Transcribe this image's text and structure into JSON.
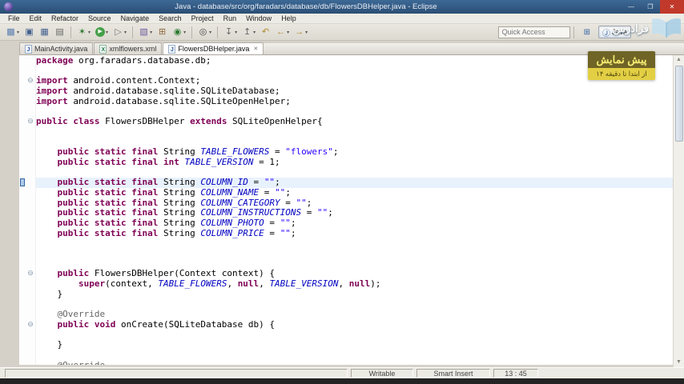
{
  "window": {
    "title": "Java - database/src/org/faradars/database/db/FlowersDBHelper.java - Eclipse",
    "controls": {
      "minimize": "—",
      "maximize": "❐",
      "close": "✕"
    }
  },
  "menubar": {
    "items": [
      "File",
      "Edit",
      "Refactor",
      "Source",
      "Navigate",
      "Search",
      "Project",
      "Run",
      "Window",
      "Help"
    ]
  },
  "toolbar": {
    "dd_glyph": "▾",
    "quick_access_placeholder": "Quick Access",
    "groups": [
      [
        {
          "name": "new-wizard-icon",
          "glyph": "▩",
          "color": "#5b7fb0",
          "dd": true
        },
        {
          "name": "save-icon",
          "glyph": "▣",
          "color": "#44618f"
        },
        {
          "name": "save-all-icon",
          "glyph": "▦",
          "color": "#44618f"
        },
        {
          "name": "print-icon",
          "glyph": "▤",
          "color": "#666666"
        }
      ],
      [
        {
          "name": "debug-icon",
          "glyph": "✶",
          "color": "#2e7d32",
          "dd": true
        },
        {
          "name": "run-icon",
          "glyph": "▶",
          "color": "#ffffff",
          "bg": "#43a047",
          "round": true,
          "dd": true
        },
        {
          "name": "run-external-tools-icon",
          "glyph": "▷",
          "color": "#777777",
          "dd": true
        }
      ],
      [
        {
          "name": "new-java-project-icon",
          "glyph": "▧",
          "color": "#6d5b9c",
          "dd": true
        },
        {
          "name": "new-package-icon",
          "glyph": "⊞",
          "color": "#8a6a3a"
        },
        {
          "name": "new-class-icon",
          "glyph": "◉",
          "color": "#2e7d32",
          "dd": true
        }
      ],
      [
        {
          "name": "search-icon",
          "glyph": "◎",
          "color": "#444444",
          "dd": true
        }
      ],
      [
        {
          "name": "next-annotation-icon",
          "glyph": "↧",
          "color": "#666666",
          "dd": true
        },
        {
          "name": "prev-annotation-icon",
          "glyph": "↥",
          "color": "#666666",
          "dd": true
        },
        {
          "name": "last-edit-location-icon",
          "glyph": "↶",
          "color": "#b08a2e"
        },
        {
          "name": "back-icon",
          "glyph": "←",
          "color": "#b08a2e",
          "dd": true
        },
        {
          "name": "forward-icon",
          "glyph": "→",
          "color": "#b08a2e",
          "dd": true
        }
      ]
    ],
    "perspectives": [
      {
        "name": "open-perspective-button",
        "glyph": "⊞",
        "label": "",
        "active": false
      },
      {
        "name": "java-perspective-button",
        "glyph": "Ⓙ",
        "label": "Java",
        "active": true
      }
    ]
  },
  "tabs": [
    {
      "label": "MainActivity.java",
      "icon": "J",
      "icon_class": "java",
      "active": false
    },
    {
      "label": "xmlflowers.xml",
      "icon": "X",
      "icon_class": "xml",
      "active": false
    },
    {
      "label": "FlowersDBHelper.java",
      "icon": "J",
      "icon_class": "java",
      "active": true,
      "close": "✕"
    }
  ],
  "editor": {
    "fold_glyph": "⊖",
    "lines": [
      {
        "seg": [
          [
            "k",
            "package"
          ],
          [
            "p",
            " org.faradars.database.db;"
          ]
        ]
      },
      {
        "seg": []
      },
      {
        "fold": true,
        "seg": [
          [
            "k",
            "import"
          ],
          [
            "p",
            " android.content.Context;"
          ]
        ]
      },
      {
        "seg": [
          [
            "k",
            "import"
          ],
          [
            "p",
            " android.database.sqlite.SQLiteDatabase;"
          ]
        ]
      },
      {
        "seg": [
          [
            "k",
            "import"
          ],
          [
            "p",
            " android.database.sqlite.SQLiteOpenHelper;"
          ]
        ]
      },
      {
        "seg": []
      },
      {
        "fold": true,
        "seg": [
          [
            "k",
            "public class"
          ],
          [
            "p",
            " FlowersDBHelper "
          ],
          [
            "k",
            "extends"
          ],
          [
            "p",
            " SQLiteOpenHelper{"
          ]
        ]
      },
      {
        "seg": []
      },
      {
        "seg": []
      },
      {
        "seg": [
          [
            "p",
            "    "
          ],
          [
            "k",
            "public static final"
          ],
          [
            "p",
            " String "
          ],
          [
            "f",
            "TABLE_FLOWERS"
          ],
          [
            "p",
            " = "
          ],
          [
            "s",
            "\"flowers\""
          ],
          [
            "p",
            ";"
          ]
        ]
      },
      {
        "seg": [
          [
            "p",
            "    "
          ],
          [
            "k",
            "public static final int"
          ],
          [
            "p",
            " "
          ],
          [
            "f",
            "TABLE_VERSION"
          ],
          [
            "p",
            " = 1;"
          ]
        ]
      },
      {
        "seg": []
      },
      {
        "hl": true,
        "seg": [
          [
            "p",
            "    "
          ],
          [
            "k",
            "public static final"
          ],
          [
            "p",
            " String "
          ],
          [
            "f",
            "COLUMN_ID"
          ],
          [
            "p",
            " = "
          ],
          [
            "s",
            "\"\""
          ],
          [
            "p",
            ";"
          ]
        ]
      },
      {
        "seg": [
          [
            "p",
            "    "
          ],
          [
            "k",
            "public static final"
          ],
          [
            "p",
            " String "
          ],
          [
            "f",
            "COLUMN_NAME"
          ],
          [
            "p",
            " = "
          ],
          [
            "s",
            "\"\""
          ],
          [
            "p",
            ";"
          ]
        ]
      },
      {
        "seg": [
          [
            "p",
            "    "
          ],
          [
            "k",
            "public static final"
          ],
          [
            "p",
            " String "
          ],
          [
            "f",
            "COLUMN_CATEGORY"
          ],
          [
            "p",
            " = "
          ],
          [
            "s",
            "\"\""
          ],
          [
            "p",
            ";"
          ]
        ]
      },
      {
        "seg": [
          [
            "p",
            "    "
          ],
          [
            "k",
            "public static final"
          ],
          [
            "p",
            " String "
          ],
          [
            "f",
            "COLUMN_INSTRUCTIONS"
          ],
          [
            "p",
            " = "
          ],
          [
            "s",
            "\"\""
          ],
          [
            "p",
            ";"
          ]
        ]
      },
      {
        "seg": [
          [
            "p",
            "    "
          ],
          [
            "k",
            "public static final"
          ],
          [
            "p",
            " String "
          ],
          [
            "f",
            "COLUMN_PHOTO"
          ],
          [
            "p",
            " = "
          ],
          [
            "s",
            "\"\""
          ],
          [
            "p",
            ";"
          ]
        ]
      },
      {
        "seg": [
          [
            "p",
            "    "
          ],
          [
            "k",
            "public static final"
          ],
          [
            "p",
            " String "
          ],
          [
            "f",
            "COLUMN_PRICE"
          ],
          [
            "p",
            " = "
          ],
          [
            "s",
            "\"\""
          ],
          [
            "p",
            ";"
          ]
        ]
      },
      {
        "seg": []
      },
      {
        "seg": []
      },
      {
        "seg": []
      },
      {
        "fold": true,
        "seg": [
          [
            "p",
            "    "
          ],
          [
            "k",
            "public"
          ],
          [
            "p",
            " FlowersDBHelper(Context context) {"
          ]
        ]
      },
      {
        "seg": [
          [
            "p",
            "        "
          ],
          [
            "k",
            "super"
          ],
          [
            "p",
            "(context, "
          ],
          [
            "f",
            "TABLE_FLOWERS"
          ],
          [
            "p",
            ", "
          ],
          [
            "k",
            "null"
          ],
          [
            "p",
            ", "
          ],
          [
            "f",
            "TABLE_VERSION"
          ],
          [
            "p",
            ", "
          ],
          [
            "k",
            "null"
          ],
          [
            "p",
            ");"
          ]
        ]
      },
      {
        "seg": [
          [
            "p",
            "    }"
          ]
        ]
      },
      {
        "seg": []
      },
      {
        "seg": [
          [
            "p",
            "    "
          ],
          [
            "a",
            "@Override"
          ]
        ]
      },
      {
        "fold": true,
        "seg": [
          [
            "p",
            "    "
          ],
          [
            "k",
            "public void"
          ],
          [
            "p",
            " onCreate(SQLiteDatabase db) {"
          ]
        ]
      },
      {
        "seg": []
      },
      {
        "seg": [
          [
            "p",
            "    }"
          ]
        ]
      },
      {
        "seg": []
      },
      {
        "seg": [
          [
            "p",
            "    "
          ],
          [
            "a",
            "@Override"
          ]
        ]
      }
    ]
  },
  "scrollbar": {
    "up": "▲",
    "down": "▼"
  },
  "statusbar": {
    "writable": "Writable",
    "insert_mode": "Smart Insert",
    "position": "13 : 45"
  },
  "watermark": {
    "brand": "فرادرس",
    "badge_title": "پیش نمایش",
    "badge_subtitle": "از ابتدا تا دقیقه ۱۴"
  },
  "colors": {
    "keyword": "#7f0055",
    "string": "#2a00ff",
    "static_field": "#0000c0",
    "annotation": "#646464",
    "current_line": "#e8f2fc",
    "close_button": "#c0392b"
  }
}
